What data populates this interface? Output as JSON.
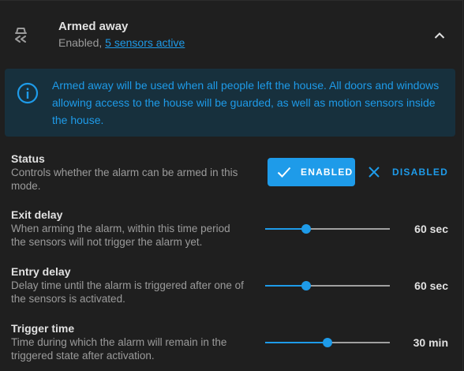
{
  "header": {
    "title": "Armed away",
    "status_prefix": "Enabled, ",
    "sensors_link": "5 sensors active",
    "mode_icon": "car-arrow-left-icon",
    "expand_icon": "chevron-up-icon"
  },
  "info": {
    "icon": "info-circle-icon",
    "text": "Armed away will be used when all people left the house. All doors and windows allowing access to the house will be guarded, as well as motion sensors inside the house."
  },
  "settings": {
    "status": {
      "title": "Status",
      "description": "Controls whether the alarm can be armed in this mode.",
      "enabled_label": "ENABLED",
      "disabled_label": "DISABLED",
      "selected": "ENABLED"
    },
    "exit_delay": {
      "title": "Exit delay",
      "description": "When arming the alarm, within this time period the sensors will not trigger the alarm yet.",
      "value_label": "60 sec",
      "slider_fraction": 0.33
    },
    "entry_delay": {
      "title": "Entry delay",
      "description": "Delay time until the alarm is triggered after one of the sensors is activated.",
      "value_label": "60 sec",
      "slider_fraction": 0.33
    },
    "trigger_time": {
      "title": "Trigger time",
      "description": "Time during which the alarm will remain in the triggered state after activation.",
      "value_label": "30 min",
      "slider_fraction": 0.5
    }
  },
  "colors": {
    "accent": "#1e9be9",
    "background": "#1f1f1f",
    "info_background": "#17303d"
  }
}
